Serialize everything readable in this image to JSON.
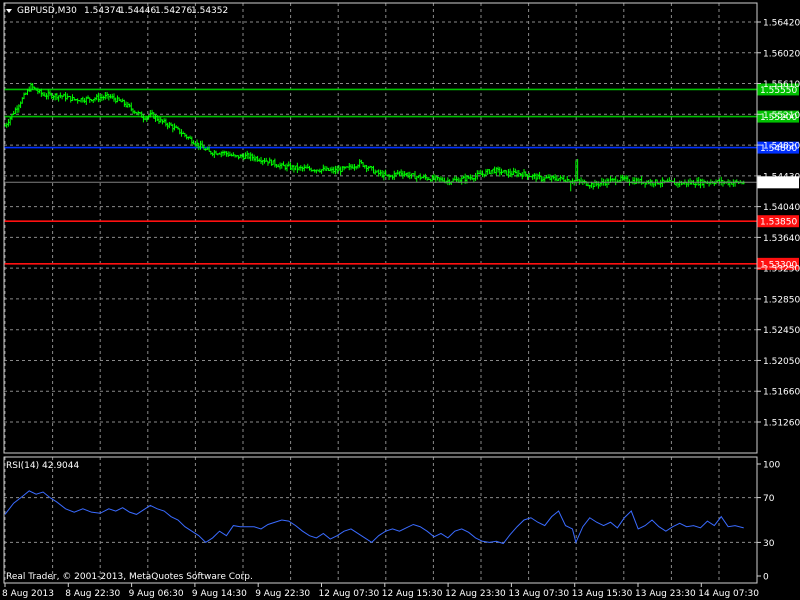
{
  "chart_data": [
    {
      "type": "bar",
      "style": "ohlc",
      "symbol_label": "GBPUSD,M30",
      "ohlc": [
        "1.54374",
        "1.54446",
        "1.54276",
        "1.54352"
      ],
      "ylim": [
        1.5126,
        1.5642
      ],
      "y_ticks": [
        "1.56420",
        "1.56020",
        "1.55610",
        "1.55210",
        "1.54820",
        "1.54430",
        "1.54040",
        "1.53640",
        "1.53250",
        "1.52850",
        "1.52450",
        "1.52050",
        "1.51660",
        "1.51260"
      ],
      "x_ticks": [
        "8 Aug 2013",
        "8 Aug 22:30",
        "9 Aug 06:30",
        "9 Aug 14:30",
        "9 Aug 22:30",
        "12 Aug 07:30",
        "12 Aug 15:30",
        "12 Aug 23:30",
        "13 Aug 07:30",
        "13 Aug 15:30",
        "13 Aug 23:30",
        "14 Aug 07:30"
      ],
      "current_price": "1.54352",
      "levels": [
        {
          "value": 1.5555,
          "label": "1.55550",
          "color": "#00c000"
        },
        {
          "value": 1.552,
          "label": "1.55200",
          "color": "#00c000"
        },
        {
          "value": 1.548,
          "label": "1.54800",
          "color": "#0030ff"
        },
        {
          "value": 1.5385,
          "label": "1.53850",
          "color": "#ff1010"
        },
        {
          "value": 1.533,
          "label": "1.53300",
          "color": "#ff1010"
        }
      ],
      "candle_color": "#00ff00",
      "close_path": [
        [
          0,
          1.5508
        ],
        [
          8,
          1.5536
        ],
        [
          15,
          1.5559
        ],
        [
          22,
          1.5548
        ],
        [
          32,
          1.5547
        ],
        [
          40,
          1.5542
        ],
        [
          50,
          1.5543
        ],
        [
          60,
          1.5546
        ],
        [
          68,
          1.5538
        ],
        [
          75,
          1.5527
        ],
        [
          80,
          1.5519
        ],
        [
          85,
          1.5522
        ],
        [
          90,
          1.5514
        ],
        [
          96,
          1.5508
        ],
        [
          104,
          1.5496
        ],
        [
          110,
          1.5486
        ],
        [
          118,
          1.5474
        ],
        [
          126,
          1.5474
        ],
        [
          133,
          1.5468
        ],
        [
          140,
          1.5469
        ],
        [
          150,
          1.5464
        ],
        [
          160,
          1.5456
        ],
        [
          170,
          1.5453
        ],
        [
          180,
          1.5452
        ],
        [
          190,
          1.545
        ],
        [
          198,
          1.5453
        ],
        [
          205,
          1.546
        ],
        [
          210,
          1.5455
        ],
        [
          214,
          1.5448
        ],
        [
          222,
          1.5442
        ],
        [
          228,
          1.5448
        ],
        [
          236,
          1.5443
        ],
        [
          246,
          1.544
        ],
        [
          256,
          1.5437
        ],
        [
          262,
          1.5438
        ],
        [
          270,
          1.5442
        ],
        [
          276,
          1.5446
        ],
        [
          282,
          1.5451
        ],
        [
          290,
          1.5447
        ],
        [
          300,
          1.5446
        ],
        [
          310,
          1.544
        ],
        [
          320,
          1.544
        ],
        [
          330,
          1.5437
        ],
        [
          340,
          1.5432
        ],
        [
          348,
          1.5436
        ],
        [
          355,
          1.5439
        ],
        [
          362,
          1.5437
        ],
        [
          370,
          1.5436
        ],
        [
          380,
          1.5435
        ],
        [
          390,
          1.5434
        ],
        [
          400,
          1.5435
        ],
        [
          410,
          1.5436
        ],
        [
          418,
          1.5435
        ],
        [
          427,
          1.5435
        ]
      ],
      "rsi": {
        "label": "RSI(14)",
        "value": "42.9044",
        "ylim": [
          0,
          100
        ],
        "y_ticks": [
          "100",
          "70",
          "30",
          "0"
        ],
        "line_color": "#3a6bff",
        "path": [
          [
            0,
            55
          ],
          [
            5,
            65
          ],
          [
            10,
            71
          ],
          [
            14,
            76
          ],
          [
            18,
            73
          ],
          [
            22,
            75
          ],
          [
            26,
            70
          ],
          [
            30,
            66
          ],
          [
            35,
            60
          ],
          [
            40,
            57
          ],
          [
            45,
            60
          ],
          [
            50,
            57
          ],
          [
            55,
            56
          ],
          [
            60,
            60
          ],
          [
            64,
            58
          ],
          [
            68,
            61
          ],
          [
            72,
            57
          ],
          [
            76,
            55
          ],
          [
            80,
            59
          ],
          [
            84,
            63
          ],
          [
            88,
            60
          ],
          [
            92,
            58
          ],
          [
            96,
            53
          ],
          [
            100,
            50
          ],
          [
            104,
            44
          ],
          [
            108,
            40
          ],
          [
            112,
            36
          ],
          [
            116,
            30
          ],
          [
            120,
            34
          ],
          [
            124,
            40
          ],
          [
            128,
            36
          ],
          [
            132,
            45
          ],
          [
            136,
            44
          ],
          [
            140,
            44
          ],
          [
            144,
            44
          ],
          [
            148,
            42
          ],
          [
            152,
            46
          ],
          [
            156,
            48
          ],
          [
            160,
            50
          ],
          [
            164,
            49
          ],
          [
            168,
            45
          ],
          [
            172,
            40
          ],
          [
            176,
            36
          ],
          [
            180,
            34
          ],
          [
            184,
            38
          ],
          [
            188,
            33
          ],
          [
            192,
            36
          ],
          [
            196,
            40
          ],
          [
            200,
            42
          ],
          [
            204,
            38
          ],
          [
            208,
            34
          ],
          [
            212,
            30
          ],
          [
            216,
            36
          ],
          [
            220,
            40
          ],
          [
            224,
            42
          ],
          [
            228,
            40
          ],
          [
            232,
            43
          ],
          [
            236,
            46
          ],
          [
            240,
            44
          ],
          [
            244,
            40
          ],
          [
            248,
            35
          ],
          [
            252,
            38
          ],
          [
            256,
            34
          ],
          [
            260,
            40
          ],
          [
            264,
            42
          ],
          [
            268,
            39
          ],
          [
            272,
            34
          ],
          [
            276,
            31
          ],
          [
            280,
            30
          ],
          [
            284,
            31
          ],
          [
            288,
            29
          ],
          [
            292,
            37
          ],
          [
            296,
            44
          ],
          [
            300,
            50
          ],
          [
            304,
            52
          ],
          [
            308,
            48
          ],
          [
            312,
            45
          ],
          [
            316,
            53
          ],
          [
            320,
            58
          ],
          [
            324,
            45
          ],
          [
            328,
            42
          ],
          [
            330,
            30
          ],
          [
            334,
            44
          ],
          [
            338,
            52
          ],
          [
            342,
            48
          ],
          [
            346,
            45
          ],
          [
            350,
            48
          ],
          [
            354,
            43
          ],
          [
            358,
            52
          ],
          [
            362,
            58
          ],
          [
            366,
            42
          ],
          [
            370,
            45
          ],
          [
            374,
            50
          ],
          [
            378,
            44
          ],
          [
            382,
            40
          ],
          [
            386,
            44
          ],
          [
            390,
            47
          ],
          [
            394,
            44
          ],
          [
            398,
            45
          ],
          [
            402,
            43
          ],
          [
            406,
            49
          ],
          [
            410,
            45
          ],
          [
            414,
            53
          ],
          [
            418,
            44
          ],
          [
            422,
            45
          ],
          [
            427,
            43
          ]
        ]
      }
    }
  ],
  "footer": {
    "copyright": "Real Trader, © 2001-2013, MetaQuotes Software Corp."
  },
  "colors": {
    "background": "#000000",
    "grid": "#8a8a8a",
    "frame": "#cfcfcf",
    "text": "#ffffff"
  }
}
